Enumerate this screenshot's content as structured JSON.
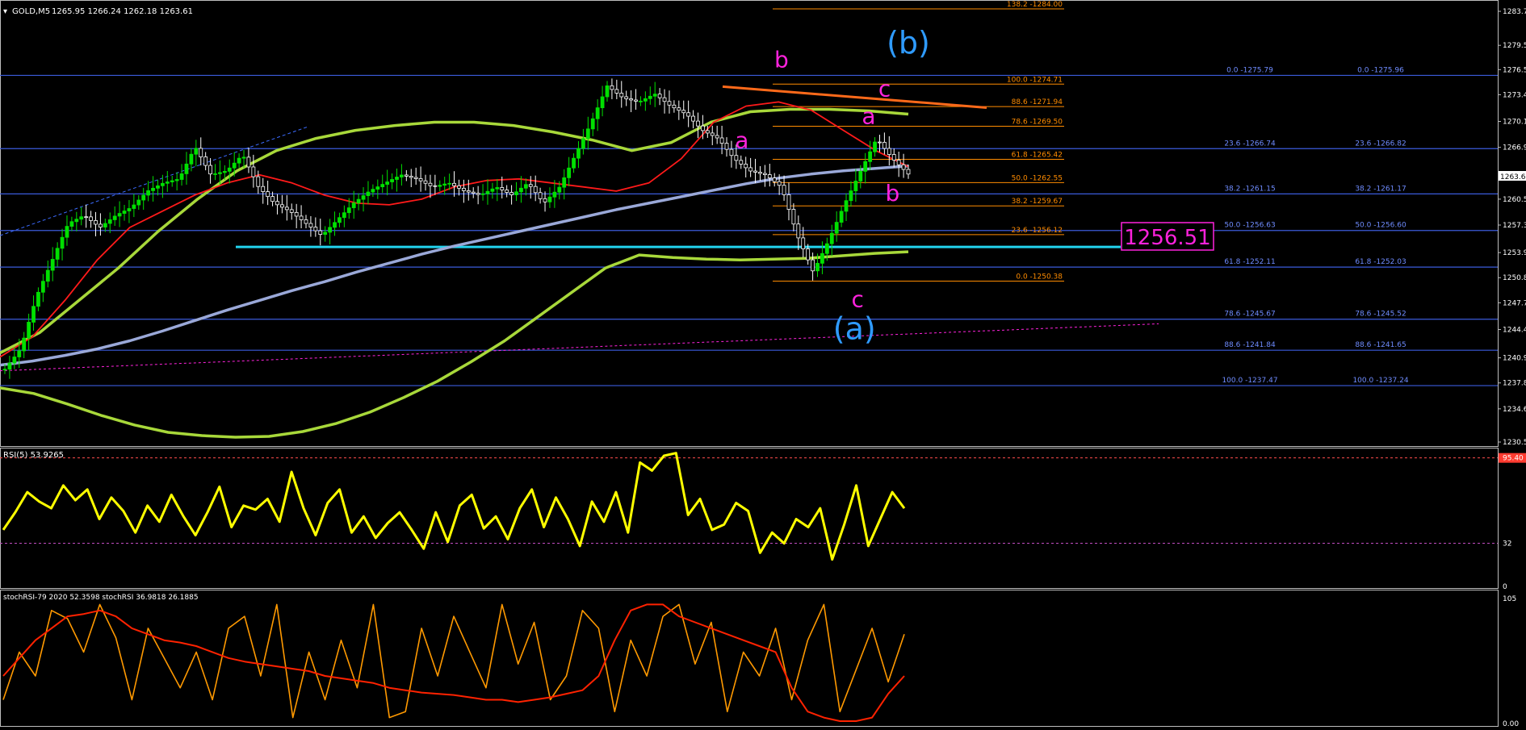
{
  "symbol_label": "GOLD,M5",
  "ohlc": "1265.95 1266.24 1262.18 1263.61",
  "price_badge": "1256.51",
  "current_price": "1263.6",
  "colors": {
    "background": "#000000",
    "grid": "#ffffff",
    "ma_fast": "#ff1a1a",
    "ma_slow": "#a8d83a",
    "ma_long": "#9aa8d8",
    "fib_orange": "#ff8c00",
    "fib_blue": "#3b5bdb",
    "wave_magenta": "#ff22dd",
    "wave_blue": "#2f9bff",
    "support_cyan": "#22d3ee",
    "rsi": "#ffff00",
    "stoch_main": "#ff9900",
    "stoch_signal": "#ff2200"
  },
  "chart_data": [
    {
      "type": "candlestick",
      "title": "GOLD,M5",
      "ylim": [
        1230.5,
        1284.5
      ],
      "y_ticks": [
        "1283.7",
        "1279.5",
        "1276.5",
        "1273.4",
        "1270.1",
        "1266.9",
        "1263.6",
        "1260.5",
        "1257.3",
        "1253.9",
        "1250.8",
        "1247.7",
        "1244.4",
        "1240.9",
        "1237.8",
        "1234.6",
        "1230.5"
      ],
      "series": [
        {
          "name": "ma_long",
          "values": [
            1240.0,
            1240.5,
            1241.2,
            1242.0,
            1243.0,
            1244.2,
            1245.5,
            1246.8,
            1248.0,
            1249.2,
            1250.3,
            1251.5,
            1252.6,
            1253.7,
            1254.7,
            1255.6,
            1256.5,
            1257.4,
            1258.3,
            1259.2,
            1260.0,
            1260.8,
            1261.6,
            1262.4,
            1263.1,
            1263.6,
            1264.0,
            1264.3,
            1264.6
          ]
        },
        {
          "name": "ma_slow",
          "values": [
            1241.5,
            1244.0,
            1248.0,
            1252.0,
            1256.5,
            1260.5,
            1264.0,
            1266.5,
            1268.0,
            1269.0,
            1269.6,
            1270.0,
            1270.0,
            1269.6,
            1268.8,
            1267.8,
            1266.5,
            1267.5,
            1270.0,
            1271.3,
            1271.6,
            1271.6,
            1271.4,
            1271.0
          ]
        },
        {
          "name": "ma_fast",
          "values": [
            1241.0,
            1243.5,
            1248.0,
            1253.0,
            1257.0,
            1259.0,
            1261.0,
            1262.5,
            1263.5,
            1262.5,
            1261.0,
            1260.0,
            1259.8,
            1260.5,
            1262.0,
            1262.8,
            1263.0,
            1262.5,
            1262.0,
            1261.5,
            1262.5,
            1265.5,
            1270.0,
            1272.0,
            1272.5,
            1271.5,
            1269.0,
            1266.5,
            1264.5
          ]
        },
        {
          "name": "envelope_bottom",
          "values": [
            1237.2,
            1236.5,
            1235.2,
            1233.8,
            1232.6,
            1231.7,
            1231.3,
            1231.1,
            1231.2,
            1231.8,
            1232.8,
            1234.2,
            1236.0,
            1238.0,
            1240.4,
            1243.0,
            1246.0,
            1249.0,
            1252.0,
            1253.6,
            1253.3,
            1253.1,
            1253.0,
            1253.1,
            1253.2,
            1253.5,
            1253.8,
            1254.0
          ]
        },
        {
          "name": "price",
          "values": [
            1239.5,
            1242.0,
            1248.5,
            1253.0,
            1257.5,
            1258.5,
            1257.0,
            1258.5,
            1259.5,
            1261.5,
            1262.5,
            1263.0,
            1267.0,
            1263.5,
            1264.0,
            1266.0,
            1262.0,
            1260.0,
            1259.0,
            1257.5,
            1256.0,
            1258.0,
            1260.0,
            1261.5,
            1262.5,
            1263.5,
            1263.0,
            1262.0,
            1262.5,
            1261.5,
            1261.0,
            1262.0,
            1261.0,
            1262.5,
            1260.0,
            1262.0,
            1266.0,
            1270.0,
            1274.5,
            1273.0,
            1272.5,
            1273.5,
            1272.0,
            1271.0,
            1269.0,
            1268.0,
            1265.5,
            1264.0,
            1263.5,
            1262.0,
            1256.0,
            1251.5,
            1255.5,
            1260.0,
            1264.0,
            1268.0,
            1265.5,
            1263.6
          ]
        }
      ],
      "fib_orange": [
        {
          "label": "138.2 -1284.00",
          "value": 1284.0
        },
        {
          "label": "100.0 -1274.71",
          "value": 1274.71
        },
        {
          "label": "88.6 -1271.94",
          "value": 1271.94
        },
        {
          "label": "78.6 -1269.50",
          "value": 1269.5
        },
        {
          "label": "61.8 -1265.42",
          "value": 1265.42
        },
        {
          "label": "50.0 -1262.55",
          "value": 1262.55
        },
        {
          "label": "38.2 -1259.67",
          "value": 1259.67
        },
        {
          "label": "23.6 -1256.12",
          "value": 1256.12
        },
        {
          "label": "0.0 -1250.38",
          "value": 1250.38
        }
      ],
      "fib_blue": [
        {
          "left": "0.0 -1275.79",
          "right": "0.0 -1275.96",
          "value": 1275.79
        },
        {
          "left": "23.6 -1266.74",
          "right": "23.6 -1266.82",
          "value": 1266.74
        },
        {
          "left": "38.2 -1261.15",
          "right": "38.2 -1261.17",
          "value": 1261.15
        },
        {
          "left": "50.0 -1256.63",
          "right": "50.0 -1256.60",
          "value": 1256.63
        },
        {
          "left": "61.8 -1252.11",
          "right": "61.8 -1252.03",
          "value": 1252.11
        },
        {
          "left": "78.6 -1245.67",
          "right": "78.6 -1245.52",
          "value": 1245.67
        },
        {
          "left": "88.6 -1241.84",
          "right": "88.6 -1241.65",
          "value": 1241.84
        },
        {
          "left": "100.0 -1237.47",
          "right": "100.0 -1237.24",
          "value": 1237.47
        }
      ],
      "support_level": 1254.6,
      "wave_labels": [
        {
          "text": "b",
          "index": 49.0,
          "value": 1276.8,
          "style": "magenta"
        },
        {
          "text": "c",
          "index": 55.5,
          "value": 1273.2,
          "style": "magenta"
        },
        {
          "text": "a",
          "index": 46.5,
          "value": 1266.8,
          "style": "magenta"
        },
        {
          "text": "a",
          "index": 54.5,
          "value": 1269.8,
          "style": "magenta"
        },
        {
          "text": "b",
          "index": 56.0,
          "value": 1260.3,
          "style": "magenta"
        },
        {
          "text": "c",
          "index": 53.8,
          "value": 1247.2,
          "style": "magenta"
        },
        {
          "text": "(b)",
          "index": 57.0,
          "value": 1278.5,
          "style": "blue"
        },
        {
          "text": "(a)",
          "index": 53.6,
          "value": 1243.2,
          "style": "blue"
        }
      ]
    },
    {
      "type": "line",
      "title": "RSI(5) 53.9265",
      "ylim": [
        0,
        100
      ],
      "y_ticks": [
        "95.40",
        "32",
        "0"
      ],
      "levels": [
        95.4,
        32
      ],
      "series": [
        {
          "name": "RSI",
          "values": [
            42,
            55,
            70,
            63,
            58,
            75,
            64,
            72,
            50,
            66,
            56,
            40,
            60,
            48,
            68,
            52,
            38,
            55,
            74,
            44,
            60,
            57,
            65,
            48,
            85,
            58,
            38,
            62,
            72,
            40,
            52,
            36,
            47,
            55,
            42,
            28,
            55,
            33,
            60,
            68,
            43,
            52,
            35,
            58,
            72,
            44,
            66,
            50,
            30,
            63,
            48,
            70,
            40,
            92,
            86,
            97,
            99,
            53,
            65,
            42,
            46,
            62,
            56,
            25,
            40,
            32,
            50,
            44,
            58,
            20,
            46,
            75,
            30,
            50,
            70,
            58
          ]
        }
      ]
    },
    {
      "type": "line",
      "title": "stochRSI-79 2020 52.3598 stochRSI 36.9818 26.1885",
      "ylim": [
        0,
        105
      ],
      "y_ticks": [
        "105",
        "0.00"
      ],
      "series": [
        {
          "name": "stochRSI",
          "values": [
            20,
            60,
            40,
            95,
            88,
            60,
            100,
            72,
            20,
            80,
            55,
            30,
            60,
            20,
            80,
            90,
            40,
            100,
            5,
            60,
            20,
            70,
            30,
            100,
            5,
            10,
            80,
            40,
            90,
            60,
            30,
            100,
            50,
            85,
            20,
            40,
            95,
            80,
            10,
            70,
            40,
            90,
            100,
            50,
            85,
            10,
            60,
            40,
            80,
            20,
            70,
            100,
            10,
            45,
            80,
            35,
            75
          ]
        },
        {
          "name": "signal",
          "values": [
            40,
            55,
            70,
            80,
            90,
            92,
            95,
            90,
            80,
            75,
            70,
            68,
            65,
            60,
            55,
            52,
            50,
            48,
            46,
            44,
            40,
            38,
            36,
            34,
            30,
            28,
            26,
            25,
            24,
            22,
            20,
            20,
            18,
            20,
            22,
            25,
            28,
            40,
            70,
            95,
            100,
            100,
            90,
            85,
            80,
            75,
            70,
            65,
            60,
            30,
            10,
            5,
            2,
            2,
            5,
            25,
            40
          ]
        }
      ]
    }
  ]
}
